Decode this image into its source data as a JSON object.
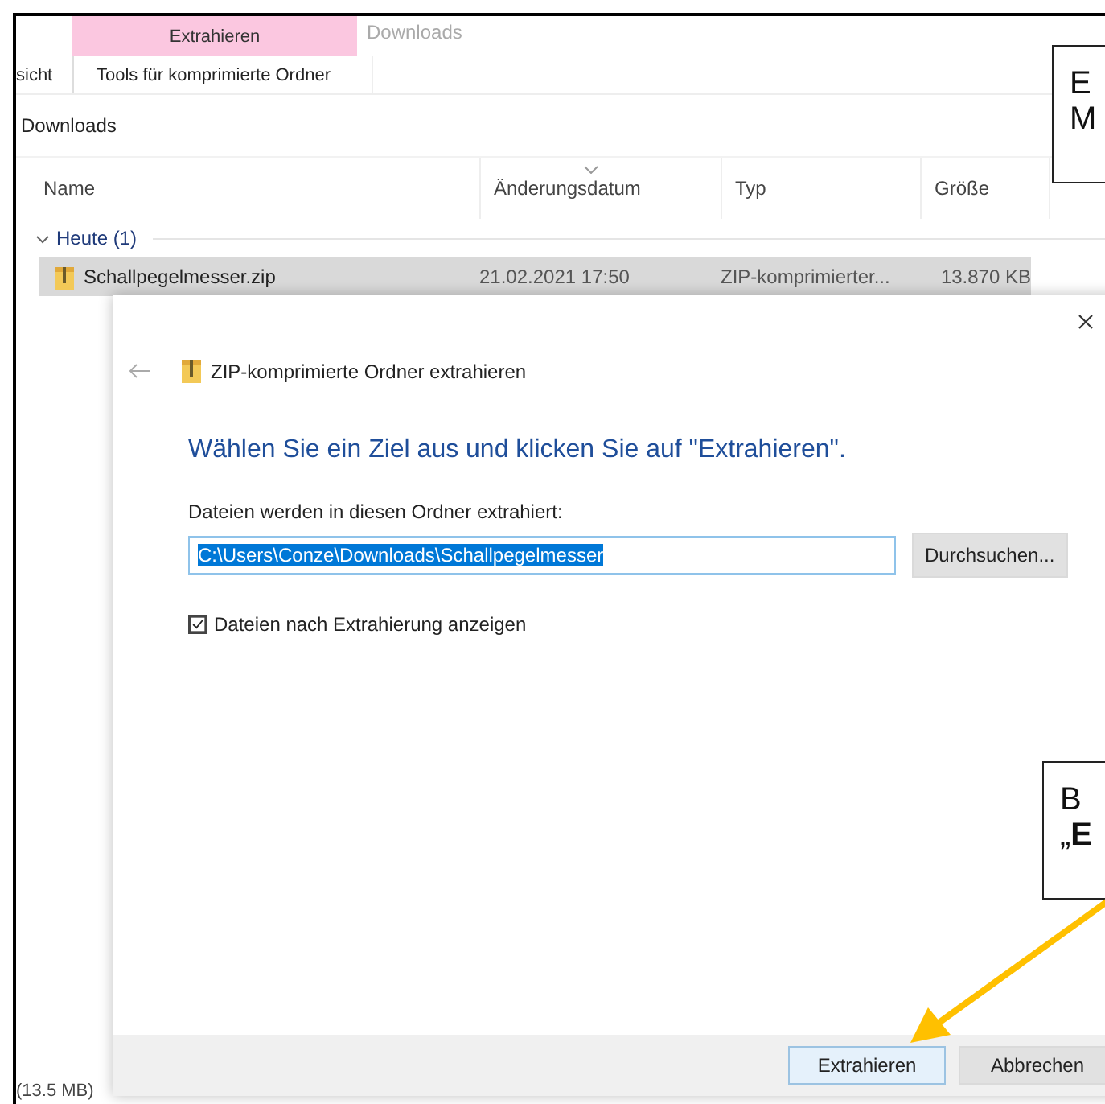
{
  "ribbon": {
    "context_group": "Extrahieren",
    "window_title": "Downloads",
    "tabs": [
      {
        "label": "sicht"
      },
      {
        "label": "Tools für komprimierte Ordner"
      }
    ]
  },
  "address": "Downloads",
  "columns": [
    {
      "label": "Name",
      "sorted": false
    },
    {
      "label": "Änderungsdatum",
      "sorted": true
    },
    {
      "label": "Typ",
      "sorted": false
    },
    {
      "label": "Größe",
      "sorted": false
    }
  ],
  "groups": [
    {
      "label": "Heute (1)",
      "expanded": true,
      "files": [
        {
          "name": "Schallpegelmesser.zip",
          "date": "21.02.2021 17:50",
          "type": "ZIP-komprimierter...",
          "size": "13.870 KB",
          "selected": true
        }
      ]
    }
  ],
  "status_bar": "(13.5 MB)",
  "dialog": {
    "title": "ZIP-komprimierte Ordner extrahieren",
    "heading": "Wählen Sie ein Ziel aus und klicken Sie auf \"Extrahieren\".",
    "path_label": "Dateien werden in diesen Ordner extrahiert:",
    "path": "C:\\Users\\Conze\\Downloads\\Schallpegelmesser",
    "path_selected": true,
    "browse_button": "Durchsuchen...",
    "checkbox": {
      "label": "Dateien nach Extrahierung anzeigen",
      "checked": true
    },
    "buttons": [
      {
        "label": "Extrahieren",
        "kind": "default"
      },
      {
        "label": "Abbrechen",
        "kind": "normal"
      }
    ]
  },
  "callouts": [
    {
      "lines": [
        "E",
        "M"
      ]
    },
    {
      "lines": [
        "B",
        "„**E**"
      ]
    }
  ]
}
